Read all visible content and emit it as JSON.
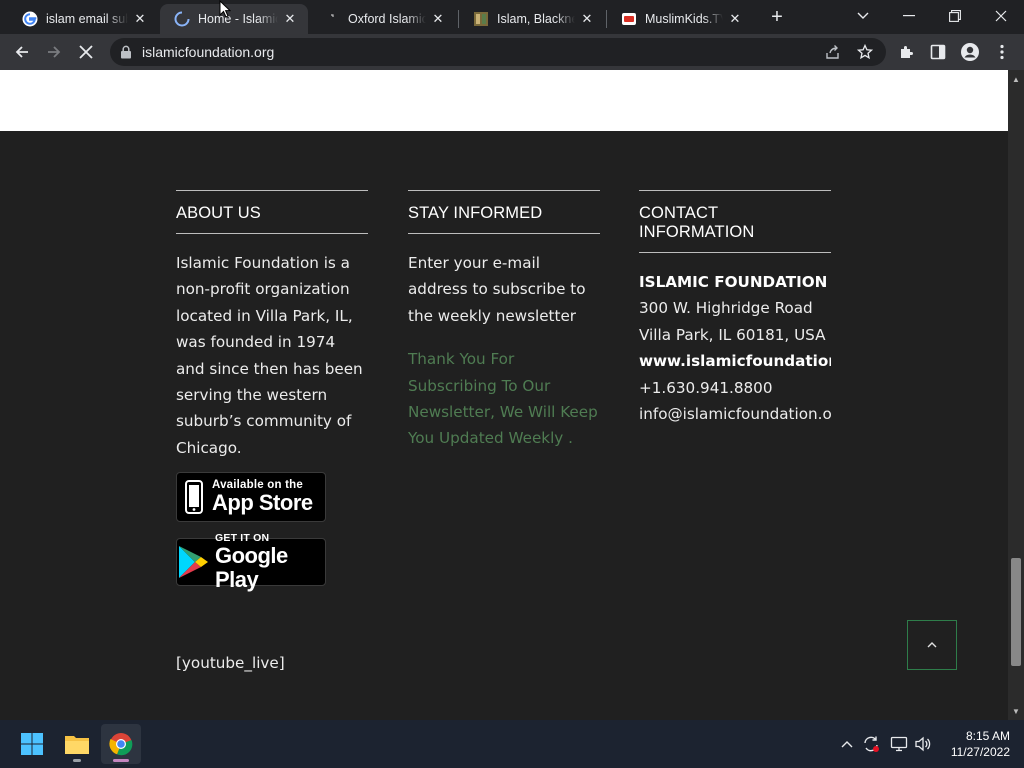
{
  "tabs": [
    {
      "title": "islam email subscribe",
      "favicon": "google-icon"
    },
    {
      "title": "Home - Islamic Foundation",
      "favicon": "loading-spinner-icon"
    },
    {
      "title": "Oxford Islamic Studies",
      "favicon": "page-icon"
    },
    {
      "title": "Islam, Blackness",
      "favicon": "book-icon"
    },
    {
      "title": "MuslimKids.TV",
      "favicon": "tv-icon"
    }
  ],
  "omnibox": {
    "url": "islamicfoundation.org"
  },
  "footer": {
    "about": {
      "heading": "ABOUT US",
      "text": "Islamic Foundation is a non-profit organization located in Villa Park, IL, was founded in 1974 and since then has been serving the western suburb’s community of Chicago."
    },
    "badges": {
      "appstore_small": "Available on the",
      "appstore_big": "App Store",
      "play_small": "GET IT ON",
      "play_big": "Google Play"
    },
    "stay": {
      "heading": "STAY INFORMED",
      "text": "Enter your e-mail address to subscribe to the weekly newsletter",
      "thanks": "Thank You For Subscribing To Our Newsletter, We Will Keep You Updated Weekly ."
    },
    "contact": {
      "heading_line1": "CONTACT",
      "heading_line2": "INFORMATION",
      "name": "ISLAMIC FOUNDATION",
      "address1": "300 W. Highridge Road",
      "address2": "Villa Park, IL 60181, USA",
      "website": "www.islamicfoundation.org",
      "phone": "+1.630.941.8800",
      "email": "info@islamicfoundation.org"
    },
    "shortcode": "[youtube_live]"
  },
  "taskbar": {
    "time": "8:15 AM",
    "date": "11/27/2022"
  },
  "colors": {
    "page_bg": "#202020",
    "thanks_green": "#4f7c52",
    "totop_border": "#2e7d4a"
  }
}
